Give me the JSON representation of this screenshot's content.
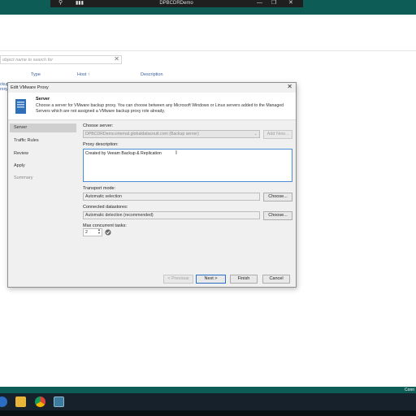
{
  "rdp_bar": {
    "title": "DPBCDRDemo"
  },
  "background_app": {
    "search_placeholder": "object name to search for",
    "columns": [
      "Type",
      "Host ↑",
      "Description"
    ],
    "left_tab": "ckup\nroxy"
  },
  "dialog": {
    "title": "Edit VMware Proxy",
    "header": {
      "title": "Server",
      "description": "Choose a server for VMware backup proxy. You can choose between any Microsoft Windows or Linux servers added to the Managed Servers which are not assigned a VMware backup proxy role already."
    },
    "nav": [
      {
        "label": "Server",
        "state": "active"
      },
      {
        "label": "Traffic Rules",
        "state": "normal"
      },
      {
        "label": "Review",
        "state": "normal"
      },
      {
        "label": "Apply",
        "state": "normal"
      },
      {
        "label": "Summary",
        "state": "dim"
      }
    ],
    "server": {
      "label": "Choose server:",
      "value": "DPBCDRDemo.internal.globaldatacoult.com (Backup server)",
      "add_new": "Add New..."
    },
    "proxy_description": {
      "label": "Proxy description:",
      "value": "Created by Veeam Backup & Replication"
    },
    "transport": {
      "label": "Transport mode:",
      "value": "Automatic selection",
      "button": "Choose..."
    },
    "datastores": {
      "label": "Connected datastores:",
      "value": "Automatic detection (recommended)",
      "button": "Choose..."
    },
    "max_tasks": {
      "label": "Max concurrent tasks:",
      "value": "2"
    },
    "buttons": {
      "previous": "< Previous",
      "next": "Next >",
      "finish": "Finish",
      "cancel": "Cancel"
    }
  },
  "taskbar": {
    "corner_text": "Conn"
  },
  "colors": {
    "teal": "#0d5c55",
    "taskbar": "#16212b",
    "accent": "#2a6fc9"
  }
}
